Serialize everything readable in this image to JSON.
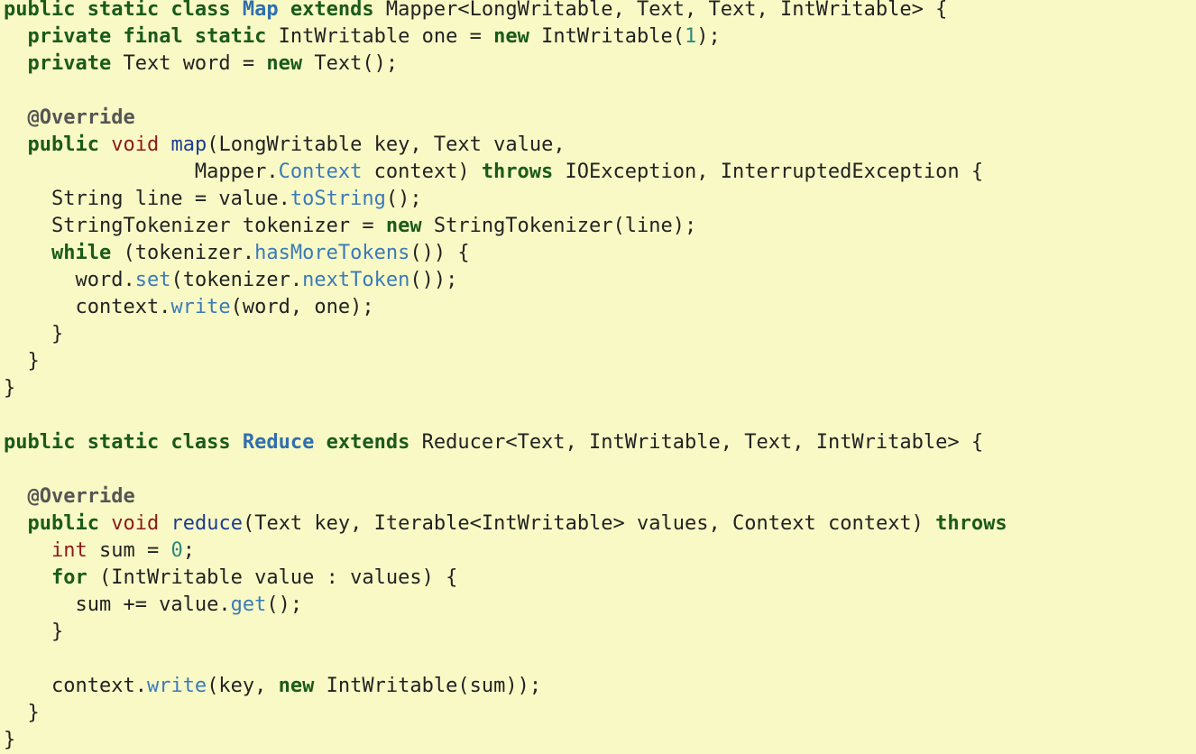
{
  "lines": [
    [
      [
        "kw",
        "public static class "
      ],
      [
        "cls",
        "Map"
      ],
      [
        "kw",
        " extends "
      ],
      [
        "pl",
        "Mapper<LongWritable, Text, Text, IntWritable> {"
      ]
    ],
    [
      [
        "pl",
        "  "
      ],
      [
        "kw",
        "private final static"
      ],
      [
        "pl",
        " IntWritable one = "
      ],
      [
        "kw",
        "new"
      ],
      [
        "pl",
        " IntWritable("
      ],
      [
        "num",
        "1"
      ],
      [
        "pl",
        ");"
      ]
    ],
    [
      [
        "pl",
        "  "
      ],
      [
        "kw",
        "private"
      ],
      [
        "pl",
        " Text word = "
      ],
      [
        "kw",
        "new"
      ],
      [
        "pl",
        " Text();"
      ]
    ],
    [],
    [
      [
        "pl",
        "  "
      ],
      [
        "ann",
        "@Override"
      ]
    ],
    [
      [
        "pl",
        "  "
      ],
      [
        "kw",
        "public"
      ],
      [
        "pl",
        " "
      ],
      [
        "ty",
        "void"
      ],
      [
        "pl",
        " "
      ],
      [
        "fn",
        "map"
      ],
      [
        "pl",
        "(LongWritable key, Text value,"
      ]
    ],
    [
      [
        "pl",
        "                Mapper."
      ],
      [
        "mc",
        "Context"
      ],
      [
        "pl",
        " context) "
      ],
      [
        "kw",
        "throws"
      ],
      [
        "pl",
        " IOException, InterruptedException {"
      ]
    ],
    [
      [
        "pl",
        "    String line = value."
      ],
      [
        "mc",
        "toString"
      ],
      [
        "pl",
        "();"
      ]
    ],
    [
      [
        "pl",
        "    StringTokenizer tokenizer = "
      ],
      [
        "kw",
        "new"
      ],
      [
        "pl",
        " StringTokenizer(line);"
      ]
    ],
    [
      [
        "pl",
        "    "
      ],
      [
        "kw",
        "while"
      ],
      [
        "pl",
        " (tokenizer."
      ],
      [
        "mc",
        "hasMoreTokens"
      ],
      [
        "pl",
        "()) {"
      ]
    ],
    [
      [
        "pl",
        "      word."
      ],
      [
        "mc",
        "set"
      ],
      [
        "pl",
        "(tokenizer."
      ],
      [
        "mc",
        "nextToken"
      ],
      [
        "pl",
        "());"
      ]
    ],
    [
      [
        "pl",
        "      context."
      ],
      [
        "mc",
        "write"
      ],
      [
        "pl",
        "(word, one);"
      ]
    ],
    [
      [
        "pl",
        "    }"
      ]
    ],
    [
      [
        "pl",
        "  }"
      ]
    ],
    [
      [
        "pl",
        "}"
      ]
    ],
    [],
    [
      [
        "kw",
        "public static class "
      ],
      [
        "cls",
        "Reduce"
      ],
      [
        "kw",
        " extends "
      ],
      [
        "pl",
        "Reducer<Text, IntWritable, Text, IntWritable> {"
      ]
    ],
    [],
    [
      [
        "pl",
        "  "
      ],
      [
        "ann",
        "@Override"
      ]
    ],
    [
      [
        "pl",
        "  "
      ],
      [
        "kw",
        "public"
      ],
      [
        "pl",
        " "
      ],
      [
        "ty",
        "void"
      ],
      [
        "pl",
        " "
      ],
      [
        "fn",
        "reduce"
      ],
      [
        "pl",
        "(Text key, Iterable<IntWritable> values, Context context) "
      ],
      [
        "kw",
        "throws"
      ]
    ],
    [
      [
        "pl",
        "    "
      ],
      [
        "ty",
        "int"
      ],
      [
        "pl",
        " sum = "
      ],
      [
        "num",
        "0"
      ],
      [
        "pl",
        ";"
      ]
    ],
    [
      [
        "pl",
        "    "
      ],
      [
        "kw",
        "for"
      ],
      [
        "pl",
        " (IntWritable value : values) {"
      ]
    ],
    [
      [
        "pl",
        "      sum += value."
      ],
      [
        "mc",
        "get"
      ],
      [
        "pl",
        "();"
      ]
    ],
    [
      [
        "pl",
        "    }"
      ]
    ],
    [],
    [
      [
        "pl",
        "    context."
      ],
      [
        "mc",
        "write"
      ],
      [
        "pl",
        "(key, "
      ],
      [
        "kw",
        "new"
      ],
      [
        "pl",
        " IntWritable(sum));"
      ]
    ],
    [
      [
        "pl",
        "  }"
      ]
    ],
    [
      [
        "pl",
        "}"
      ]
    ]
  ],
  "colors": {
    "background": "#f9f9c6",
    "keyword": "#1a5a1a",
    "type": "#8b1a1a",
    "class_name": "#2f6fad",
    "method_decl": "#1b3d8f",
    "method_call": "#3a7ab8",
    "number": "#2a8a7a",
    "annotation": "#555555",
    "plain": "#222222"
  }
}
